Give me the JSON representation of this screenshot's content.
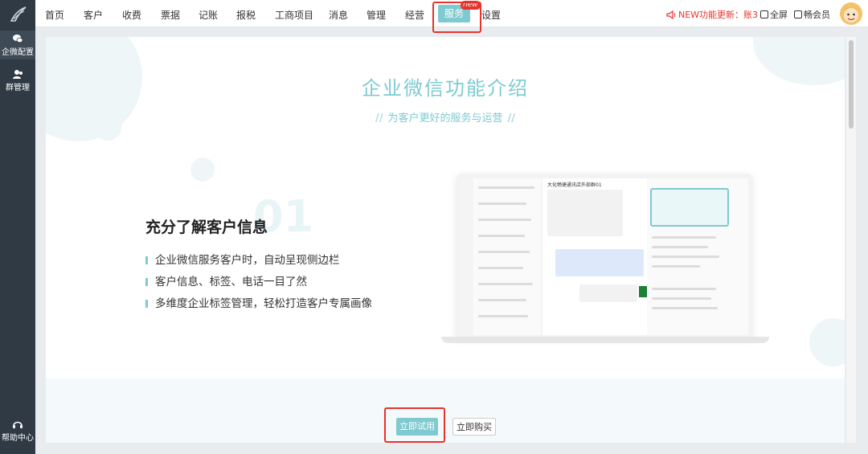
{
  "sidebar": {
    "items": [
      {
        "label": "企微配置",
        "icon": "wechat-work-icon",
        "active": true
      },
      {
        "label": "群管理",
        "icon": "group-icon",
        "active": false
      }
    ],
    "help": {
      "label": "帮助中心",
      "icon": "help-headset-icon"
    }
  },
  "nav": {
    "items": [
      "首页",
      "客户",
      "收费",
      "票据",
      "记账",
      "报税",
      "工商项目",
      "消息",
      "管理",
      "经营",
      "服务",
      "设置"
    ],
    "active": "服务",
    "new_badge": "new"
  },
  "header": {
    "news": "NEW功能更新：账3",
    "fullscreen": "全屏",
    "member": "畅会员"
  },
  "page": {
    "title": "企业微信功能介绍",
    "subtitle": "为客户更好的服务与运营",
    "feature": {
      "number": "01",
      "title": "充分了解客户信息",
      "bullets": [
        "企业微信服务客户时，自动呈现侧边栏",
        "客户信息、标签、电话一目了然",
        "多维度企业标签管理，轻松打造客户专属画像"
      ]
    },
    "mock_chat_title": "大化畅捷通讯店外部群01"
  },
  "actions": {
    "try": "立即试用",
    "buy": "立即购买"
  },
  "colors": {
    "accent": "#7fcad0",
    "highlight": "#e8332b",
    "sidebar": "#2f3a45"
  }
}
